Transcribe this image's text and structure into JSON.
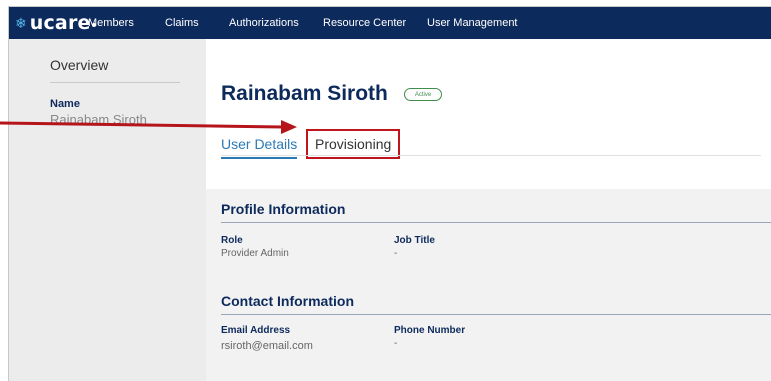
{
  "brand": {
    "logo_text": "ucare",
    "logo_mark": "❄"
  },
  "nav": {
    "items": [
      {
        "label": "Members"
      },
      {
        "label": "Claims"
      },
      {
        "label": "Authorizations"
      },
      {
        "label": "Resource Center"
      },
      {
        "label": "User Management"
      }
    ]
  },
  "sidebar": {
    "overview": "Overview",
    "name_label": "Name",
    "name_value": "Rainabam Siroth"
  },
  "user": {
    "name": "Rainabam Siroth",
    "status": "Active"
  },
  "tabs": [
    {
      "label": "User Details"
    },
    {
      "label": "Provisioning"
    }
  ],
  "sections": {
    "profile": {
      "title": "Profile Information",
      "role_label": "Role",
      "role_value": "Provider Admin",
      "job_title_label": "Job Title",
      "job_title_value": "-"
    },
    "contact": {
      "title": "Contact Information",
      "email_label": "Email Address",
      "email_value": "rsiroth@email.com",
      "phone_label": "Phone Number",
      "phone_value": "-"
    }
  },
  "colors": {
    "nav_background": "#0d2a5c",
    "accent_blue": "#2a7ab8",
    "highlight_red": "#c0151b",
    "status_green": "#3e8e4c"
  }
}
